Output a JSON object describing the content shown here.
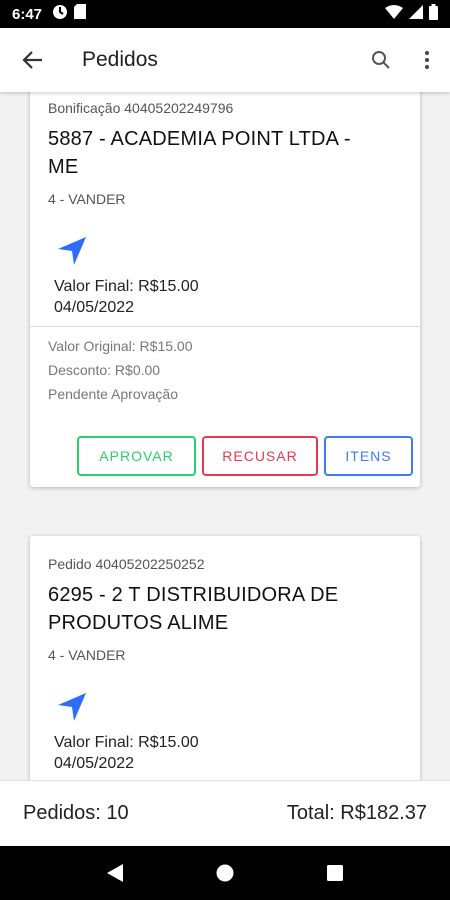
{
  "status_bar": {
    "time": "6:47",
    "icons": [
      "sync-icon",
      "sd-card-icon",
      "wifi-icon",
      "signal-icon",
      "battery-icon"
    ]
  },
  "app_bar": {
    "title": "Pedidos",
    "icons": [
      "back-arrow-icon",
      "search-icon",
      "more-vert-icon"
    ]
  },
  "orders": [
    {
      "label": "Bonificação 40405202249796",
      "client_line1": "5887 - ACADEMIA POINT LTDA -",
      "client_line2": "ME",
      "seller": "4 - VANDER",
      "valor_final": "Valor Final: R$15.00",
      "date": "04/05/2022",
      "valor_original": "Valor Original: R$15.00",
      "desconto": "Desconto: R$0.00",
      "status": "Pendente Aprovação",
      "buttons": {
        "aprovar": "APROVAR",
        "recusar": "RECUSAR",
        "itens": "ITENS"
      }
    },
    {
      "label": "Pedido 40405202250252",
      "client_line1": "6295 - 2 T DISTRIBUIDORA DE",
      "client_line2": "PRODUTOS ALIME",
      "seller": "4 - VANDER",
      "valor_final": "Valor Final: R$15.00",
      "date": "04/05/2022"
    }
  ],
  "footer": {
    "count": "Pedidos: 10",
    "total": "Total: R$182.37"
  },
  "colors": {
    "approve": "#2ecc71",
    "reject": "#e53950",
    "items": "#3a7bff",
    "nav_icon": "#2f6df6"
  },
  "nav_bar": {
    "icons": [
      "back-triangle-icon",
      "home-circle-icon",
      "recents-square-icon"
    ]
  }
}
